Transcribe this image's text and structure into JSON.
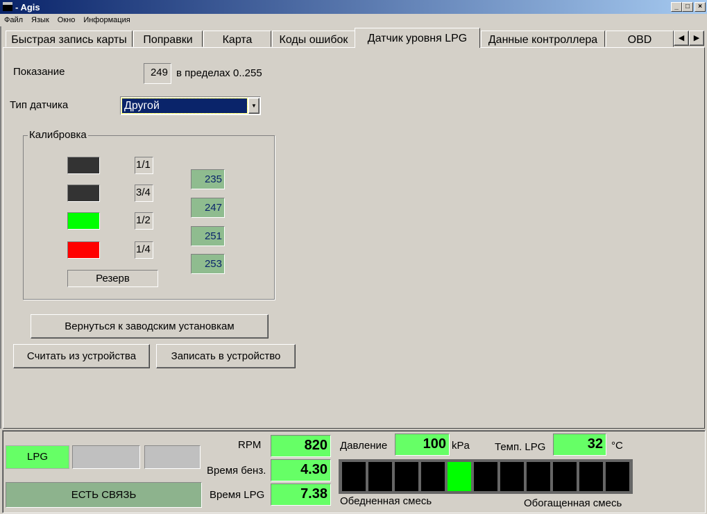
{
  "window": {
    "title": "- Agis",
    "icon_text": "LPG"
  },
  "menu": [
    "Файл",
    "Язык",
    "Окно",
    "Информация"
  ],
  "tabs": [
    "Быстрая запись карты",
    "Поправки",
    "Карта",
    "Коды ошибок",
    "Датчик уровня LPG",
    "Данные контроллера",
    "OBD"
  ],
  "active_tab": 4,
  "sensor": {
    "reading_label": "Показание",
    "reading_value": "249",
    "range_text": "в пределах 0..255",
    "type_label": "Тип датчика",
    "type_value": "Другой"
  },
  "calibration": {
    "title": "Калибровка",
    "levels": [
      {
        "label": "1/1",
        "color": "#333333"
      },
      {
        "label": "3/4",
        "color": "#333333"
      },
      {
        "label": "1/2",
        "color": "#00ff00"
      },
      {
        "label": "1/4",
        "color": "#ff0000"
      }
    ],
    "reserve_label": "Резерв",
    "thresholds": [
      "235",
      "247",
      "251",
      "253"
    ]
  },
  "buttons": {
    "factory_reset": "Вернуться к заводским установкам",
    "read_device": "Считать из устройства",
    "write_device": "Записать в устройство"
  },
  "status": {
    "fuel_mode": "LPG",
    "connection": "ЕСТЬ СВЯЗЬ",
    "rpm_label": "RPM",
    "rpm": "820",
    "petrol_time_label": "Время бенз.",
    "petrol_time": "4.30",
    "lpg_time_label": "Время LPG",
    "lpg_time": "7.38",
    "pressure_label": "Давление",
    "pressure": "100",
    "pressure_unit": "kPa",
    "temp_label": "Темп. LPG",
    "temp": "32",
    "temp_unit": "°C",
    "lean_label": "Обедненная смесь",
    "rich_label": "Обогащенная смесь",
    "mixture_segments": 11,
    "mixture_active_index": 4
  }
}
